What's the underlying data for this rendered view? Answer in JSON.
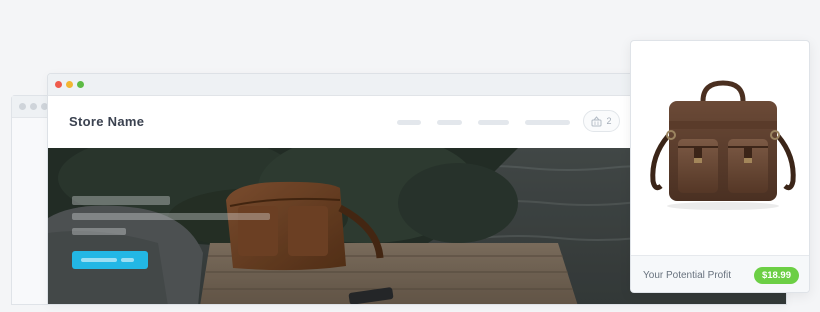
{
  "header": {
    "store_name": "Store Name",
    "cart_count": "2"
  },
  "product_card": {
    "profit_label": "Your Potential Profit",
    "profit_value": "$18.99"
  },
  "colors": {
    "accent_button": "#23b7e5",
    "profit_badge": "#6ccf45",
    "traffic_red": "#ef5b4c",
    "traffic_yellow": "#f2b632",
    "traffic_green": "#5dbb45"
  },
  "icons": {
    "cart": "basket-icon"
  }
}
